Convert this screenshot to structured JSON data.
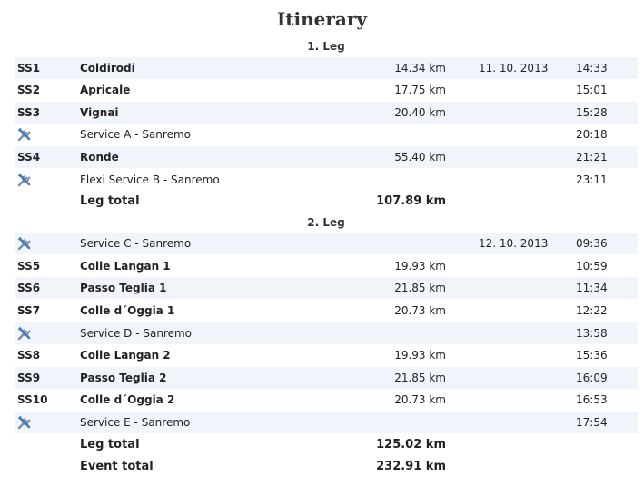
{
  "title": "Itinerary",
  "legs": [
    {
      "label": "1. Leg",
      "rows": [
        {
          "type": "stage",
          "code": "SS1",
          "name": "Coldirodi",
          "distance": "14.34 km",
          "date": "11. 10. 2013",
          "time": "14:33"
        },
        {
          "type": "stage",
          "code": "SS2",
          "name": "Apricale",
          "distance": "17.75 km",
          "date": "",
          "time": "15:01"
        },
        {
          "type": "stage",
          "code": "SS3",
          "name": "Vignai",
          "distance": "20.40 km",
          "date": "",
          "time": "15:28"
        },
        {
          "type": "service",
          "icon": "wrench-icon",
          "name": "Service A - Sanremo",
          "distance": "",
          "date": "",
          "time": "20:18"
        },
        {
          "type": "stage",
          "code": "SS4",
          "name": "Ronde",
          "distance": "55.40 km",
          "date": "",
          "time": "21:21"
        },
        {
          "type": "service",
          "icon": "wrench-icon",
          "name": "Flexi Service B - Sanremo",
          "distance": "",
          "date": "",
          "time": "23:11"
        }
      ],
      "total_label": "Leg total",
      "total_distance": "107.89 km"
    },
    {
      "label": "2. Leg",
      "rows": [
        {
          "type": "service",
          "icon": "wrench-icon",
          "name": "Service C - Sanremo",
          "distance": "",
          "date": "12. 10. 2013",
          "time": "09:36"
        },
        {
          "type": "stage",
          "code": "SS5",
          "name": "Colle Langan 1",
          "distance": "19.93 km",
          "date": "",
          "time": "10:59"
        },
        {
          "type": "stage",
          "code": "SS6",
          "name": "Passo Teglia 1",
          "distance": "21.85 km",
          "date": "",
          "time": "11:34"
        },
        {
          "type": "stage",
          "code": "SS7",
          "name": "Colle d´Oggia 1",
          "distance": "20.73 km",
          "date": "",
          "time": "12:22"
        },
        {
          "type": "service",
          "icon": "wrench-icon",
          "name": "Service D - Sanremo",
          "distance": "",
          "date": "",
          "time": "13:58"
        },
        {
          "type": "stage",
          "code": "SS8",
          "name": "Colle Langan 2",
          "distance": "19.93 km",
          "date": "",
          "time": "15:36"
        },
        {
          "type": "stage",
          "code": "SS9",
          "name": "Passo Teglia 2",
          "distance": "21.85 km",
          "date": "",
          "time": "16:09"
        },
        {
          "type": "stage",
          "code": "SS10",
          "name": "Colle d´Oggia 2",
          "distance": "20.73 km",
          "date": "",
          "time": "16:53"
        },
        {
          "type": "service",
          "icon": "wrench-icon",
          "name": "Service E - Sanremo",
          "distance": "",
          "date": "",
          "time": "17:54"
        }
      ],
      "total_label": "Leg total",
      "total_distance": "125.02 km"
    }
  ],
  "event_total_label": "Event total",
  "event_total_distance": "232.91 km",
  "colors": {
    "row_alt": "#f1f5fb",
    "icon_blue": "#3f7fbf",
    "icon_steel": "#7a8da3"
  }
}
